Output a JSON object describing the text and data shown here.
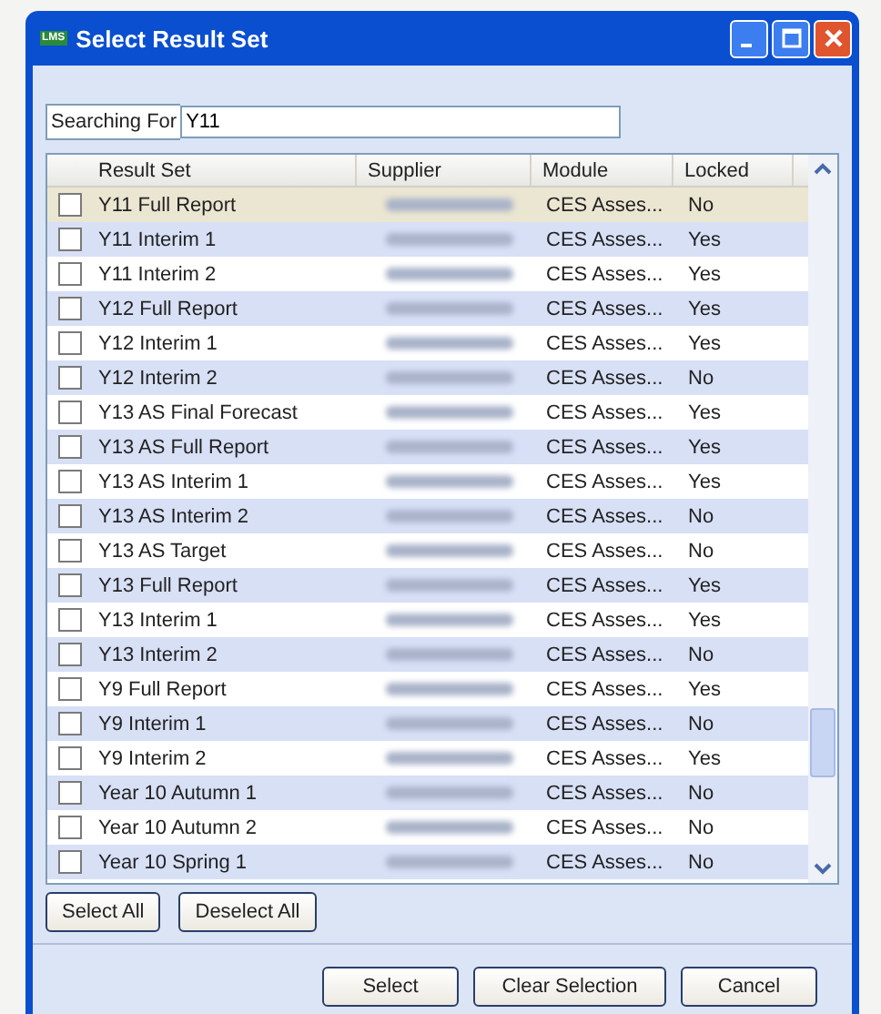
{
  "window": {
    "title": "Select Result Set",
    "icon": "LMS"
  },
  "search": {
    "label": "Searching For",
    "value": "Y11"
  },
  "table": {
    "columns": [
      "Result Set",
      "Supplier",
      "Module",
      "Locked"
    ],
    "rows": [
      {
        "result_set": "Y11 Full Report",
        "module": "CES Asses...",
        "locked": "No",
        "checked": false,
        "selected": true
      },
      {
        "result_set": "Y11 Interim 1",
        "module": "CES Asses...",
        "locked": "Yes",
        "checked": false,
        "selected": false
      },
      {
        "result_set": "Y11 Interim 2",
        "module": "CES Asses...",
        "locked": "Yes",
        "checked": false,
        "selected": false
      },
      {
        "result_set": "Y12 Full Report",
        "module": "CES Asses...",
        "locked": "Yes",
        "checked": false,
        "selected": false
      },
      {
        "result_set": "Y12 Interim 1",
        "module": "CES Asses...",
        "locked": "Yes",
        "checked": false,
        "selected": false
      },
      {
        "result_set": "Y12 Interim 2",
        "module": "CES Asses...",
        "locked": "No",
        "checked": false,
        "selected": false
      },
      {
        "result_set": "Y13 AS Final Forecast",
        "module": "CES Asses...",
        "locked": "Yes",
        "checked": false,
        "selected": false
      },
      {
        "result_set": "Y13 AS Full Report",
        "module": "CES Asses...",
        "locked": "Yes",
        "checked": false,
        "selected": false
      },
      {
        "result_set": "Y13 AS Interim 1",
        "module": "CES Asses...",
        "locked": "Yes",
        "checked": false,
        "selected": false
      },
      {
        "result_set": "Y13 AS Interim 2",
        "module": "CES Asses...",
        "locked": "No",
        "checked": false,
        "selected": false
      },
      {
        "result_set": "Y13 AS Target",
        "module": "CES Asses...",
        "locked": "No",
        "checked": false,
        "selected": false
      },
      {
        "result_set": "Y13 Full Report",
        "module": "CES Asses...",
        "locked": "Yes",
        "checked": false,
        "selected": false
      },
      {
        "result_set": "Y13 Interim 1",
        "module": "CES Asses...",
        "locked": "Yes",
        "checked": false,
        "selected": false
      },
      {
        "result_set": "Y13 Interim 2",
        "module": "CES Asses...",
        "locked": "No",
        "checked": false,
        "selected": false
      },
      {
        "result_set": "Y9 Full Report",
        "module": "CES Asses...",
        "locked": "Yes",
        "checked": false,
        "selected": false
      },
      {
        "result_set": "Y9 Interim 1",
        "module": "CES Asses...",
        "locked": "No",
        "checked": false,
        "selected": false
      },
      {
        "result_set": "Y9 Interim 2",
        "module": "CES Asses...",
        "locked": "Yes",
        "checked": false,
        "selected": false
      },
      {
        "result_set": "Year 10 Autumn 1",
        "module": "CES Asses...",
        "locked": "No",
        "checked": false,
        "selected": false
      },
      {
        "result_set": "Year 10 Autumn 2",
        "module": "CES Asses...",
        "locked": "No",
        "checked": false,
        "selected": false
      },
      {
        "result_set": "Year 10 Spring 1",
        "module": "CES Asses...",
        "locked": "No",
        "checked": false,
        "selected": false
      }
    ]
  },
  "list_buttons": [
    "Select All",
    "Deselect All"
  ],
  "dialog_buttons": [
    "Select",
    "Clear Selection",
    "Cancel"
  ]
}
